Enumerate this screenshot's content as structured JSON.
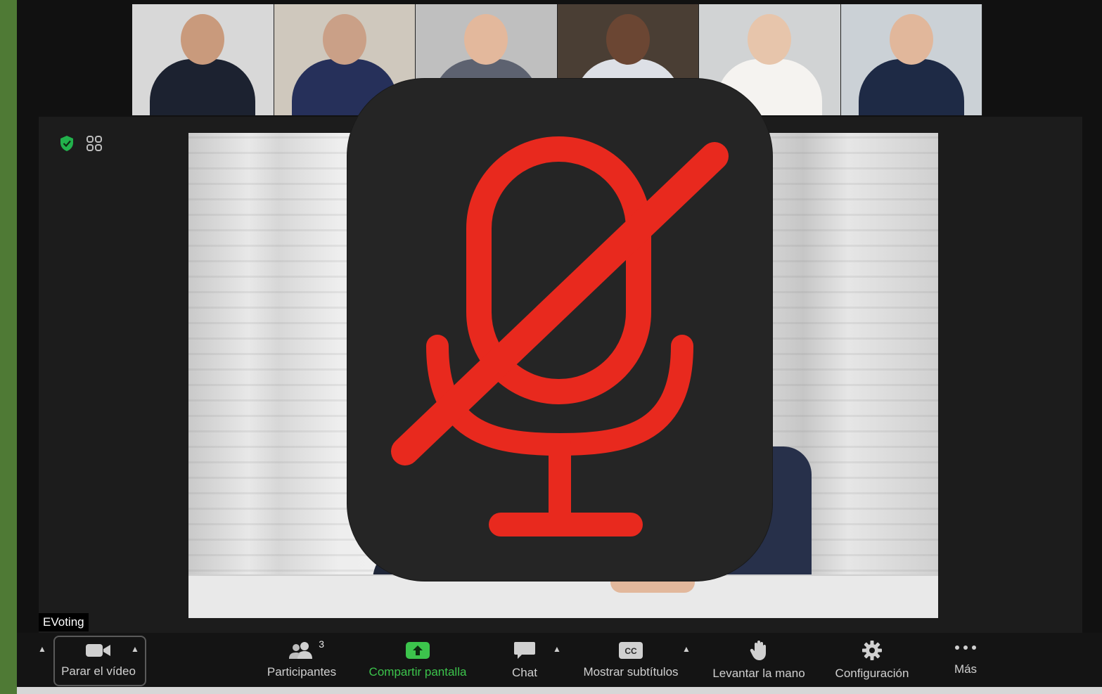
{
  "window": {
    "name_label": "EVoting"
  },
  "gallery": {
    "participants": [
      {
        "skin": "#c99a7c",
        "shirt": "#1c2230",
        "bg": "#d8d8d8"
      },
      {
        "skin": "#caa087",
        "shirt": "#26305a",
        "bg": "#cfc8bd"
      },
      {
        "skin": "#e3b89c",
        "shirt": "#5d6270",
        "bg": "#bfbfbf"
      },
      {
        "skin": "#6b4633",
        "shirt": "#dde0e6",
        "bg": "#4a3e34"
      },
      {
        "skin": "#e7c5ab",
        "shirt": "#f5f3f0",
        "bg": "#d1d3d4"
      },
      {
        "skin": "#e1b79b",
        "shirt": "#1e2a45",
        "bg": "#cbd1d6"
      }
    ]
  },
  "status": {
    "security_icon": "shield-check-icon",
    "view_icon": "grid-view-icon"
  },
  "overlay": {
    "icon": "microphone-muted-icon",
    "color": "#e8291e"
  },
  "toolbar": {
    "video_label": "Parar el vídeo",
    "participants_label": "Participantes",
    "participants_count": "3",
    "share_label": "Compartir pantalla",
    "chat_label": "Chat",
    "subtitles_label": "Mostrar subtítulos",
    "raise_hand_label": "Levantar la mano",
    "settings_label": "Configuración",
    "more_label": "Más"
  },
  "colors": {
    "accent_green": "#3cc44c",
    "mute_red": "#e8291e",
    "frame_green": "#4f7a35"
  }
}
